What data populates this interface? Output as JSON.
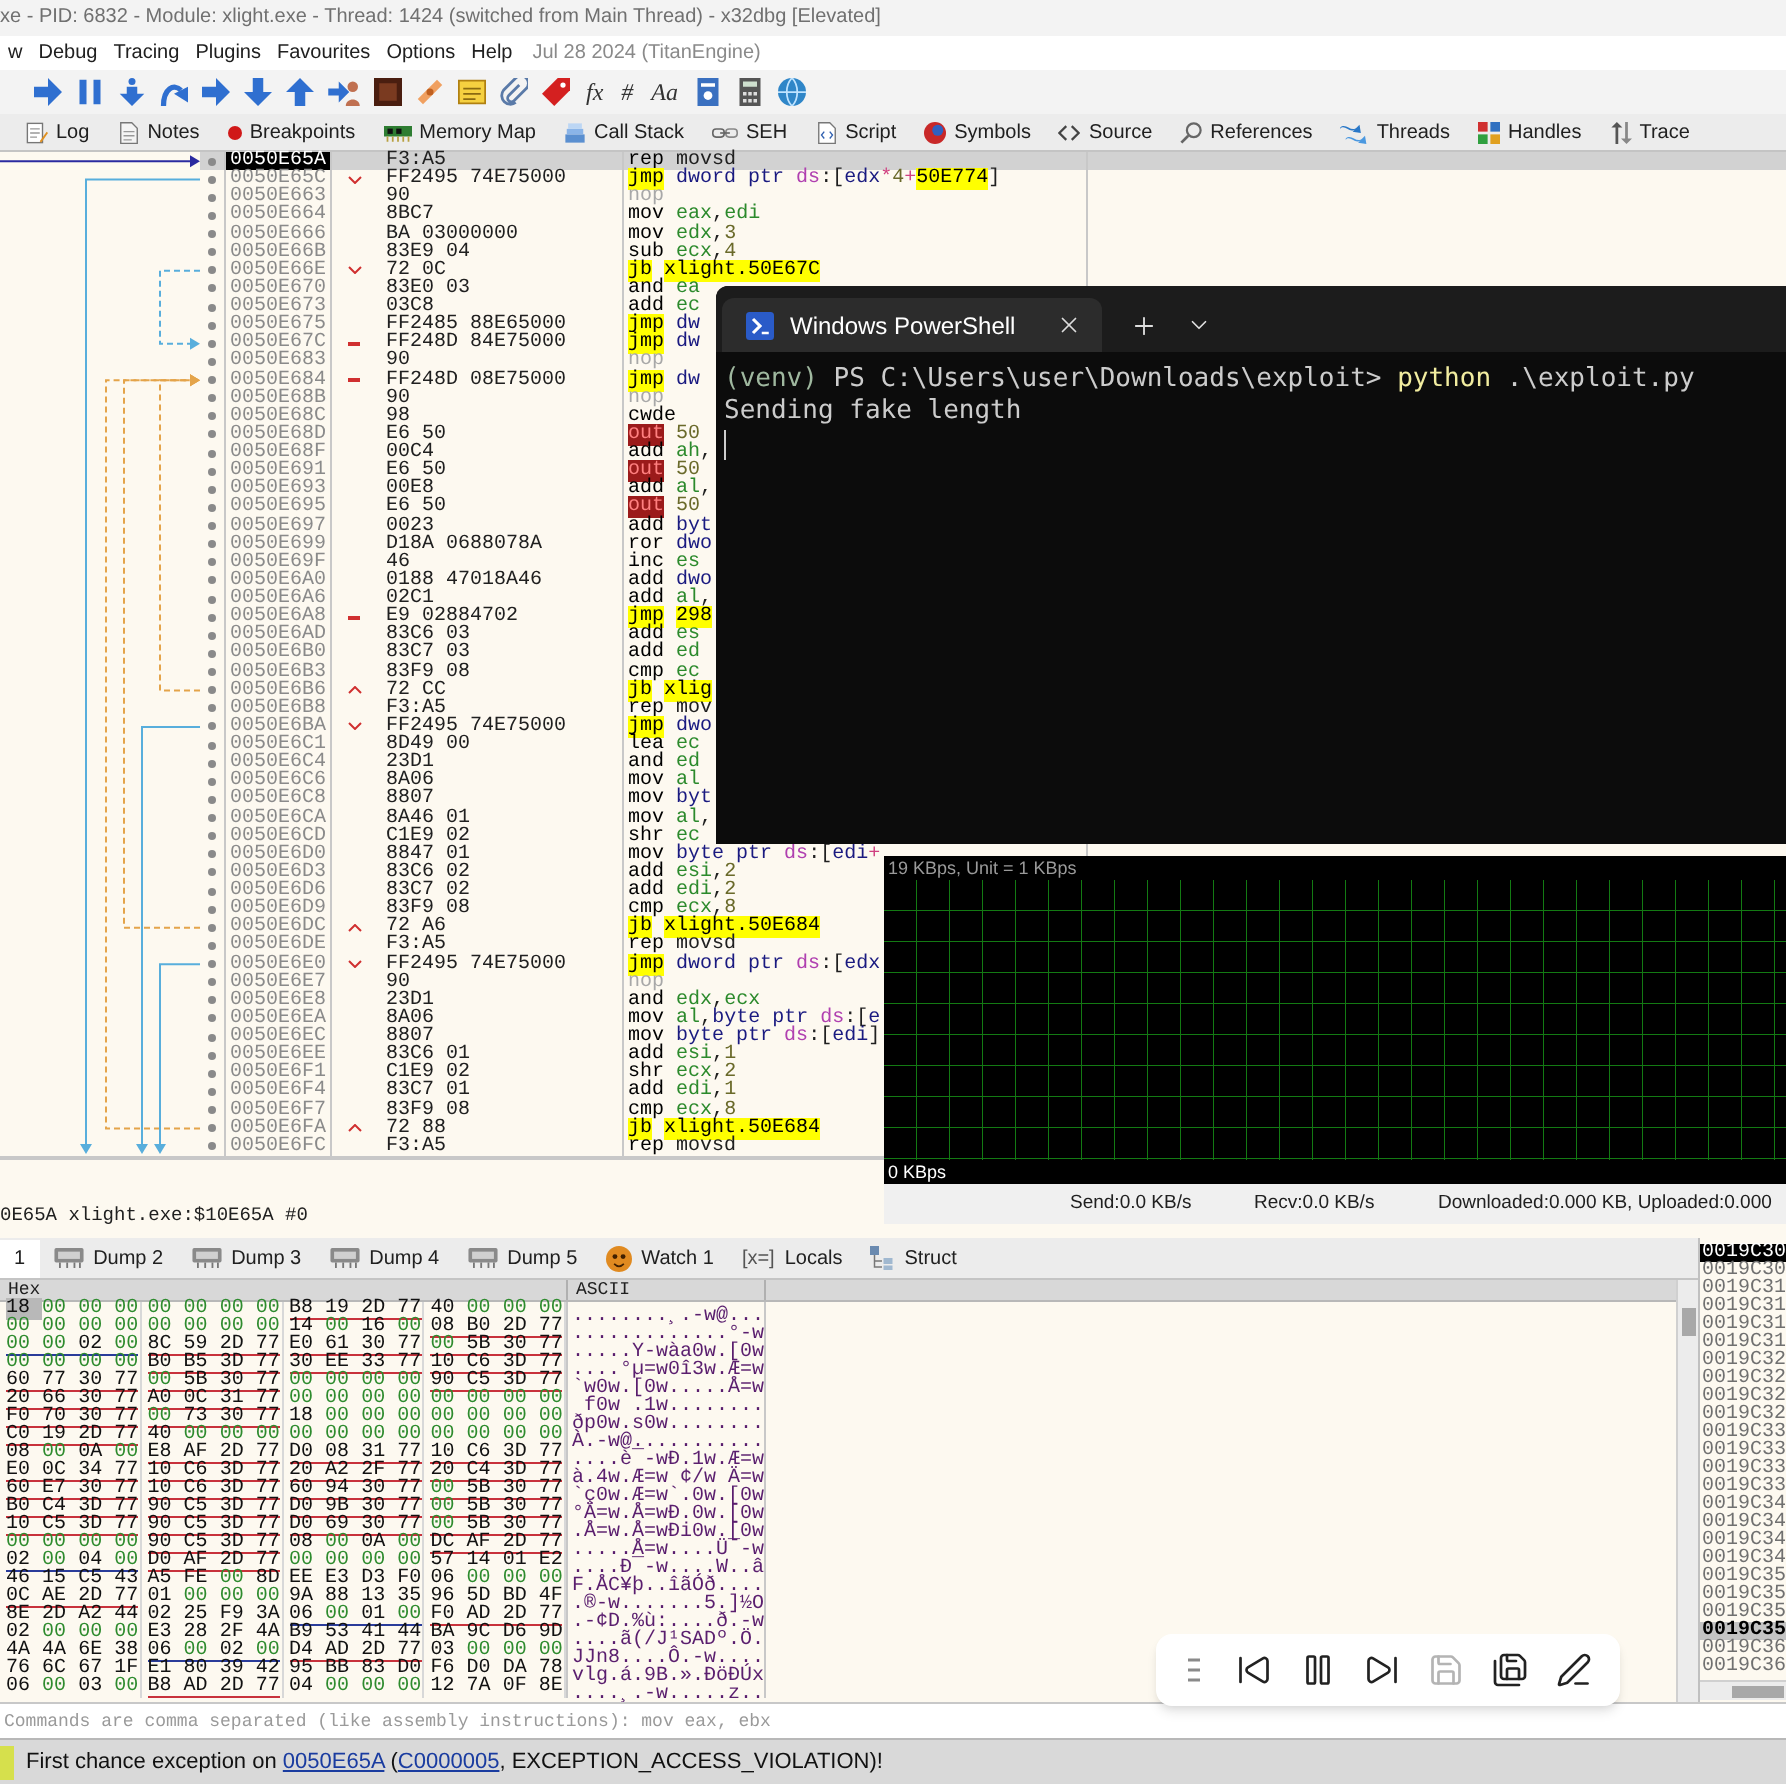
{
  "window": {
    "title": "xe - PID: 6832 - Module: xlight.exe - Thread: 1424 (switched from Main Thread) - x32dbg [Elevated]"
  },
  "menu": {
    "items": [
      "w",
      "Debug",
      "Tracing",
      "Plugins",
      "Favourites",
      "Options",
      "Help"
    ],
    "build_info": "Jul 28 2024 (TitanEngine)"
  },
  "toolbar": [
    {
      "kind": "run"
    },
    {
      "kind": "pause"
    },
    {
      "kind": "step-into"
    },
    {
      "kind": "step-over"
    },
    {
      "kind": "run-right"
    },
    {
      "kind": "run-down"
    },
    {
      "kind": "run-up"
    },
    {
      "kind": "run-user"
    },
    {
      "kind": "tile"
    },
    {
      "kind": "bandage"
    },
    {
      "kind": "note"
    },
    {
      "kind": "clip"
    },
    {
      "kind": "tag"
    },
    {
      "kind": "text",
      "label": "fx"
    },
    {
      "kind": "text",
      "label": "#"
    },
    {
      "kind": "text",
      "label": "Aa"
    },
    {
      "kind": "doc"
    },
    {
      "kind": "calc"
    },
    {
      "kind": "globe"
    }
  ],
  "tabs": [
    {
      "label": "Log",
      "kind": "log",
      "selected": false
    },
    {
      "label": "Notes",
      "kind": "notes",
      "selected": false
    },
    {
      "label": "Breakpoints",
      "kind": "breakpoints",
      "selected": false
    },
    {
      "label": "Memory Map",
      "kind": "memory",
      "selected": false
    },
    {
      "label": "Call Stack",
      "kind": "callstack",
      "selected": false
    },
    {
      "label": "SEH",
      "kind": "seh",
      "selected": false
    },
    {
      "label": "Script",
      "kind": "script",
      "selected": false
    },
    {
      "label": "Symbols",
      "kind": "symbols",
      "selected": false
    },
    {
      "label": "Source",
      "kind": "source",
      "selected": false
    },
    {
      "label": "References",
      "kind": "references",
      "selected": false
    },
    {
      "label": "Threads",
      "kind": "threads",
      "selected": false
    },
    {
      "label": "Handles",
      "kind": "handles",
      "selected": false
    },
    {
      "label": "Trace",
      "kind": "trace",
      "selected": false
    }
  ],
  "disassembly": {
    "rows": [
      {
        "address": "0050E65A",
        "bytes": "F3:A5",
        "selected": true,
        "instr": [
          {
            "text": "rep",
            "kind": "mn"
          },
          {
            "text": " movsd",
            "kind": "p"
          }
        ]
      },
      {
        "address": "0050E65C",
        "bytes": "FF2495 74E75000",
        "selected": false,
        "branch": {
          "kind": "down"
        },
        "instr": [
          {
            "text": "jmp",
            "kind": "jmp"
          },
          {
            "text": " dword ptr ",
            "kind": "size"
          },
          {
            "text": "ds",
            "kind": "seg"
          },
          {
            "text": ":[",
            "kind": "p"
          },
          {
            "text": "edx",
            "kind": "size"
          },
          {
            "text": "*",
            "kind": "op"
          },
          {
            "text": "4",
            "kind": "num"
          },
          {
            "text": "+",
            "kind": "op"
          },
          {
            "text": "50E774",
            "kind": "lbl"
          },
          {
            "text": "]",
            "kind": "p"
          }
        ]
      },
      {
        "address": "0050E663",
        "bytes": "90",
        "selected": false,
        "instr": [
          {
            "text": "nop",
            "kind": "nop"
          }
        ]
      },
      {
        "address": "0050E664",
        "bytes": "8BC7",
        "selected": false,
        "instr": [
          {
            "text": "mov",
            "kind": "mn"
          },
          {
            "text": " eax",
            "kind": "reg"
          },
          {
            "text": ",",
            "kind": "p"
          },
          {
            "text": "edi",
            "kind": "reg"
          }
        ]
      },
      {
        "address": "0050E666",
        "bytes": "BA 03000000",
        "selected": false,
        "instr": [
          {
            "text": "mov",
            "kind": "mn"
          },
          {
            "text": " edx",
            "kind": "reg"
          },
          {
            "text": ",",
            "kind": "p"
          },
          {
            "text": "3",
            "kind": "num"
          }
        ]
      },
      {
        "address": "0050E66B",
        "bytes": "83E9 04",
        "selected": false,
        "instr": [
          {
            "text": "sub",
            "kind": "mn"
          },
          {
            "text": " ecx",
            "kind": "reg"
          },
          {
            "text": ",",
            "kind": "p"
          },
          {
            "text": "4",
            "kind": "num"
          }
        ]
      },
      {
        "address": "0050E66E",
        "bytes": "72 0C",
        "selected": false,
        "branch": {
          "kind": "down"
        },
        "instr": [
          {
            "text": "jb",
            "kind": "jmp"
          },
          {
            "text": " xlight.50E67C",
            "kind": "lbl"
          }
        ]
      },
      {
        "address": "0050E670",
        "bytes": "83E0 03",
        "selected": false,
        "instr": [
          {
            "text": "and",
            "kind": "mn"
          },
          {
            "text": " ea",
            "kind": "reg"
          }
        ]
      },
      {
        "address": "0050E673",
        "bytes": "03C8",
        "selected": false,
        "instr": [
          {
            "text": "add",
            "kind": "mn"
          },
          {
            "text": " ec",
            "kind": "reg"
          }
        ]
      },
      {
        "address": "0050E675",
        "bytes": "FF2485 88E65000",
        "selected": false,
        "instr": [
          {
            "text": "jmp",
            "kind": "jmp"
          },
          {
            "text": " dw",
            "kind": "size"
          }
        ]
      },
      {
        "address": "0050E67C",
        "bytes": "FF248D 84E75000",
        "selected": false,
        "branch": {
          "kind": "far"
        },
        "instr": [
          {
            "text": "jmp",
            "kind": "jmp"
          },
          {
            "text": " dw",
            "kind": "size"
          }
        ]
      },
      {
        "address": "0050E683",
        "bytes": "90",
        "selected": false,
        "instr": [
          {
            "text": "nop",
            "kind": "nop"
          }
        ]
      },
      {
        "address": "0050E684",
        "bytes": "FF248D 08E75000",
        "selected": false,
        "branch": {
          "kind": "far"
        },
        "instr": [
          {
            "text": "jmp",
            "kind": "jmp"
          },
          {
            "text": " dw",
            "kind": "size"
          }
        ]
      },
      {
        "address": "0050E68B",
        "bytes": "90",
        "selected": false,
        "instr": [
          {
            "text": "nop",
            "kind": "nop"
          }
        ]
      },
      {
        "address": "0050E68C",
        "bytes": "98",
        "selected": false,
        "instr": [
          {
            "text": "cwde",
            "kind": "mn"
          }
        ]
      },
      {
        "address": "0050E68D",
        "bytes": "E6 50",
        "selected": false,
        "instr": [
          {
            "text": "out",
            "kind": "bad"
          },
          {
            "text": " 50",
            "kind": "num"
          }
        ]
      },
      {
        "address": "0050E68F",
        "bytes": "00C4",
        "selected": false,
        "instr": [
          {
            "text": "add",
            "kind": "mn"
          },
          {
            "text": " ah",
            "kind": "reg"
          },
          {
            "text": ",",
            "kind": "p"
          }
        ]
      },
      {
        "address": "0050E691",
        "bytes": "E6 50",
        "selected": false,
        "instr": [
          {
            "text": "out",
            "kind": "bad"
          },
          {
            "text": " 50",
            "kind": "num"
          }
        ]
      },
      {
        "address": "0050E693",
        "bytes": "00E8",
        "selected": false,
        "instr": [
          {
            "text": "add",
            "kind": "mn"
          },
          {
            "text": " al",
            "kind": "reg"
          },
          {
            "text": ",",
            "kind": "p"
          }
        ]
      },
      {
        "address": "0050E695",
        "bytes": "E6 50",
        "selected": false,
        "instr": [
          {
            "text": "out",
            "kind": "bad"
          },
          {
            "text": " 50",
            "kind": "num"
          }
        ]
      },
      {
        "address": "0050E697",
        "bytes": "0023",
        "selected": false,
        "instr": [
          {
            "text": "add",
            "kind": "mn"
          },
          {
            "text": " byt",
            "kind": "size"
          }
        ]
      },
      {
        "address": "0050E699",
        "bytes": "D18A 0688078A",
        "selected": false,
        "instr": [
          {
            "text": "ror",
            "kind": "mn"
          },
          {
            "text": " dwo",
            "kind": "size"
          }
        ]
      },
      {
        "address": "0050E69F",
        "bytes": "46",
        "selected": false,
        "instr": [
          {
            "text": "inc",
            "kind": "mn"
          },
          {
            "text": " es",
            "kind": "reg"
          }
        ]
      },
      {
        "address": "0050E6A0",
        "bytes": "0188 47018A46",
        "selected": false,
        "instr": [
          {
            "text": "add",
            "kind": "mn"
          },
          {
            "text": " dwo",
            "kind": "size"
          }
        ]
      },
      {
        "address": "0050E6A6",
        "bytes": "02C1",
        "selected": false,
        "instr": [
          {
            "text": "add",
            "kind": "mn"
          },
          {
            "text": " al",
            "kind": "reg"
          },
          {
            "text": ",",
            "kind": "p"
          }
        ]
      },
      {
        "address": "0050E6A8",
        "bytes": "E9 02884702",
        "selected": false,
        "branch": {
          "kind": "far"
        },
        "instr": [
          {
            "text": "jmp",
            "kind": "jmp"
          },
          {
            "text": " 298",
            "kind": "lbl"
          }
        ]
      },
      {
        "address": "0050E6AD",
        "bytes": "83C6 03",
        "selected": false,
        "instr": [
          {
            "text": "add",
            "kind": "mn"
          },
          {
            "text": " es",
            "kind": "reg"
          }
        ]
      },
      {
        "address": "0050E6B0",
        "bytes": "83C7 03",
        "selected": false,
        "instr": [
          {
            "text": "add",
            "kind": "mn"
          },
          {
            "text": " ed",
            "kind": "reg"
          }
        ]
      },
      {
        "address": "0050E6B3",
        "bytes": "83F9 08",
        "selected": false,
        "instr": [
          {
            "text": "cmp",
            "kind": "mn"
          },
          {
            "text": " ec",
            "kind": "reg"
          }
        ]
      },
      {
        "address": "0050E6B6",
        "bytes": "72 CC",
        "selected": false,
        "branch": {
          "kind": "up"
        },
        "instr": [
          {
            "text": "jb",
            "kind": "jmp"
          },
          {
            "text": " xlig",
            "kind": "lbl"
          }
        ]
      },
      {
        "address": "0050E6B8",
        "bytes": "F3:A5",
        "selected": false,
        "instr": [
          {
            "text": "rep",
            "kind": "mn"
          },
          {
            "text": " mov",
            "kind": "p"
          }
        ]
      },
      {
        "address": "0050E6BA",
        "bytes": "FF2495 74E75000",
        "selected": false,
        "branch": {
          "kind": "down"
        },
        "instr": [
          {
            "text": "jmp",
            "kind": "jmp"
          },
          {
            "text": " dwo",
            "kind": "size"
          }
        ]
      },
      {
        "address": "0050E6C1",
        "bytes": "8D49 00",
        "selected": false,
        "instr": [
          {
            "text": "lea",
            "kind": "mn"
          },
          {
            "text": " ec",
            "kind": "reg"
          }
        ]
      },
      {
        "address": "0050E6C4",
        "bytes": "23D1",
        "selected": false,
        "instr": [
          {
            "text": "and",
            "kind": "mn"
          },
          {
            "text": " ed",
            "kind": "reg"
          }
        ]
      },
      {
        "address": "0050E6C6",
        "bytes": "8A06",
        "selected": false,
        "instr": [
          {
            "text": "mov",
            "kind": "mn"
          },
          {
            "text": " al",
            "kind": "reg"
          }
        ]
      },
      {
        "address": "0050E6C8",
        "bytes": "8807",
        "selected": false,
        "instr": [
          {
            "text": "mov",
            "kind": "mn"
          },
          {
            "text": " byt",
            "kind": "size"
          }
        ]
      },
      {
        "address": "0050E6CA",
        "bytes": "8A46 01",
        "selected": false,
        "instr": [
          {
            "text": "mov",
            "kind": "mn"
          },
          {
            "text": " al",
            "kind": "reg"
          },
          {
            "text": ",",
            "kind": "p"
          }
        ]
      },
      {
        "address": "0050E6CD",
        "bytes": "C1E9 02",
        "selected": false,
        "instr": [
          {
            "text": "shr",
            "kind": "mn"
          },
          {
            "text": " ec",
            "kind": "reg"
          }
        ]
      },
      {
        "address": "0050E6D0",
        "bytes": "8847 01",
        "selected": false,
        "instr": [
          {
            "text": "mov",
            "kind": "mn"
          },
          {
            "text": " byte ptr ",
            "kind": "size"
          },
          {
            "text": "ds",
            "kind": "seg"
          },
          {
            "text": ":[",
            "kind": "p"
          },
          {
            "text": "edi",
            "kind": "size"
          },
          {
            "text": "+",
            "kind": "op"
          }
        ]
      },
      {
        "address": "0050E6D3",
        "bytes": "83C6 02",
        "selected": false,
        "instr": [
          {
            "text": "add",
            "kind": "mn"
          },
          {
            "text": " esi",
            "kind": "reg"
          },
          {
            "text": ",",
            "kind": "p"
          },
          {
            "text": "2",
            "kind": "num"
          }
        ]
      },
      {
        "address": "0050E6D6",
        "bytes": "83C7 02",
        "selected": false,
        "instr": [
          {
            "text": "add",
            "kind": "mn"
          },
          {
            "text": " edi",
            "kind": "reg"
          },
          {
            "text": ",",
            "kind": "p"
          },
          {
            "text": "2",
            "kind": "num"
          }
        ]
      },
      {
        "address": "0050E6D9",
        "bytes": "83F9 08",
        "selected": false,
        "instr": [
          {
            "text": "cmp",
            "kind": "mn"
          },
          {
            "text": " ecx",
            "kind": "reg"
          },
          {
            "text": ",",
            "kind": "p"
          },
          {
            "text": "8",
            "kind": "num"
          }
        ]
      },
      {
        "address": "0050E6DC",
        "bytes": "72 A6",
        "selected": false,
        "branch": {
          "kind": "up"
        },
        "instr": [
          {
            "text": "jb",
            "kind": "jmp"
          },
          {
            "text": " xlight.50E684",
            "kind": "lbl"
          }
        ]
      },
      {
        "address": "0050E6DE",
        "bytes": "F3:A5",
        "selected": false,
        "instr": [
          {
            "text": "rep",
            "kind": "mn"
          },
          {
            "text": " movsd",
            "kind": "p"
          }
        ]
      },
      {
        "address": "0050E6E0",
        "bytes": "FF2495 74E75000",
        "selected": false,
        "branch": {
          "kind": "down"
        },
        "instr": [
          {
            "text": "jmp",
            "kind": "jmp"
          },
          {
            "text": " dword ptr ",
            "kind": "size"
          },
          {
            "text": "ds",
            "kind": "seg"
          },
          {
            "text": ":[",
            "kind": "p"
          },
          {
            "text": "edx",
            "kind": "size"
          }
        ]
      },
      {
        "address": "0050E6E7",
        "bytes": "90",
        "selected": false,
        "instr": [
          {
            "text": "nop",
            "kind": "nop"
          }
        ]
      },
      {
        "address": "0050E6E8",
        "bytes": "23D1",
        "selected": false,
        "instr": [
          {
            "text": "and",
            "kind": "mn"
          },
          {
            "text": " edx",
            "kind": "reg"
          },
          {
            "text": ",",
            "kind": "p"
          },
          {
            "text": "ecx",
            "kind": "reg"
          }
        ]
      },
      {
        "address": "0050E6EA",
        "bytes": "8A06",
        "selected": false,
        "instr": [
          {
            "text": "mov",
            "kind": "mn"
          },
          {
            "text": " al",
            "kind": "reg"
          },
          {
            "text": ",",
            "kind": "p"
          },
          {
            "text": "byte ptr ",
            "kind": "size"
          },
          {
            "text": "ds",
            "kind": "seg"
          },
          {
            "text": ":[",
            "kind": "p"
          },
          {
            "text": "e",
            "kind": "size"
          }
        ]
      },
      {
        "address": "0050E6EC",
        "bytes": "8807",
        "selected": false,
        "instr": [
          {
            "text": "mov",
            "kind": "mn"
          },
          {
            "text": " byte ptr ",
            "kind": "size"
          },
          {
            "text": "ds",
            "kind": "seg"
          },
          {
            "text": ":[",
            "kind": "p"
          },
          {
            "text": "edi",
            "kind": "size"
          },
          {
            "text": "]",
            "kind": "p"
          }
        ]
      },
      {
        "address": "0050E6EE",
        "bytes": "83C6 01",
        "selected": false,
        "instr": [
          {
            "text": "add",
            "kind": "mn"
          },
          {
            "text": " esi",
            "kind": "reg"
          },
          {
            "text": ",",
            "kind": "p"
          },
          {
            "text": "1",
            "kind": "num"
          }
        ]
      },
      {
        "address": "0050E6F1",
        "bytes": "C1E9 02",
        "selected": false,
        "instr": [
          {
            "text": "shr",
            "kind": "mn"
          },
          {
            "text": " ecx",
            "kind": "reg"
          },
          {
            "text": ",",
            "kind": "p"
          },
          {
            "text": "2",
            "kind": "num"
          }
        ]
      },
      {
        "address": "0050E6F4",
        "bytes": "83C7 01",
        "selected": false,
        "instr": [
          {
            "text": "add",
            "kind": "mn"
          },
          {
            "text": " edi",
            "kind": "reg"
          },
          {
            "text": ",",
            "kind": "p"
          },
          {
            "text": "1",
            "kind": "num"
          }
        ]
      },
      {
        "address": "0050E6F7",
        "bytes": "83F9 08",
        "selected": false,
        "instr": [
          {
            "text": "cmp",
            "kind": "mn"
          },
          {
            "text": " ecx",
            "kind": "reg"
          },
          {
            "text": ",",
            "kind": "p"
          },
          {
            "text": "8",
            "kind": "num"
          }
        ]
      },
      {
        "address": "0050E6FA",
        "bytes": "72 88",
        "selected": false,
        "branch": {
          "kind": "up"
        },
        "instr": [
          {
            "text": "jb",
            "kind": "jmp"
          },
          {
            "text": " xlight.50E684",
            "kind": "lbl"
          }
        ]
      },
      {
        "address": "0050E6FC",
        "bytes": "F3:A5",
        "selected": false,
        "instr": [
          {
            "text": "rep",
            "kind": "mn"
          },
          {
            "text": " movsd",
            "kind": "p"
          }
        ]
      }
    ]
  },
  "terminal": {
    "tab": {
      "title": "Windows PowerShell",
      "selected": true
    },
    "lines": [
      [
        {
          "text": "(venv) ",
          "kind": "venv"
        },
        {
          "text": "PS C:\\Users\\user\\Downloads\\exploit> ",
          "kind": "plain"
        },
        {
          "text": "python",
          "kind": "cmd"
        },
        {
          "text": " .\\exploit.py",
          "kind": "plain"
        }
      ],
      [
        {
          "text": "Sending fake length",
          "kind": "plain"
        }
      ]
    ],
    "cursor": true
  },
  "net_monitor": {
    "scale": "19 KBps, Unit = 1 KBps",
    "zero": "0 KBps",
    "status": [
      "Send:0.0 KB/s",
      "Recv:0.0 KB/s",
      "Downloaded:0.000 KB, Uploaded:0.000"
    ]
  },
  "info_line": "0E65A xlight.exe:$10E65A #0",
  "dump_tabs": [
    {
      "label": "1",
      "kind": "clipped",
      "selected": true
    },
    {
      "label": "Dump 2",
      "kind": "dump",
      "selected": false
    },
    {
      "label": "Dump 3",
      "kind": "dump",
      "selected": false
    },
    {
      "label": "Dump 4",
      "kind": "dump",
      "selected": false
    },
    {
      "label": "Dump 5",
      "kind": "dump",
      "selected": false
    },
    {
      "label": "Watch 1",
      "kind": "watch",
      "selected": false
    },
    {
      "label": "Locals",
      "kind": "locals",
      "glyph": "[x=]",
      "selected": false
    },
    {
      "label": "Struct",
      "kind": "struct",
      "selected": false
    }
  ],
  "hex": {
    "columns": [
      "Hex",
      "ASCII"
    ],
    "rows": [
      {
        "selected": true,
        "groups": [
          {
            "bytes": "18 00 00 00"
          },
          {
            "bytes": "00 00 00 00"
          },
          {
            "bytes": "B8 19 2D 77",
            "color": "#c8323c"
          },
          {
            "bytes": "40 00 00 00"
          }
        ],
        "ascii": "........¸.-w@..."
      },
      {
        "selected": false,
        "groups": [
          {
            "bytes": "00 00 00 00"
          },
          {
            "bytes": "00 00 00 00"
          },
          {
            "bytes": "14 00 16 00"
          },
          {
            "bytes": "08 B0 2D 77",
            "color": "#c8323c"
          }
        ],
        "ascii": ".............°-w"
      },
      {
        "selected": false,
        "groups": [
          {
            "bytes": "00 00 02 00",
            "color": "#2a3c9a"
          },
          {
            "bytes": "8C 59 2D 77",
            "color": "#c8323c"
          },
          {
            "bytes": "E0 61 30 77",
            "color": "#c8323c"
          },
          {
            "bytes": "00 5B 30 77",
            "color": "#c8323c"
          }
        ],
        "ascii": ".....Y-wàa0w.[0w"
      },
      {
        "selected": false,
        "groups": [
          {
            "bytes": "00 00 00 00"
          },
          {
            "bytes": "B0 B5 3D 77",
            "color": "#c8323c"
          },
          {
            "bytes": "30 EE 33 77",
            "color": "#c8323c"
          },
          {
            "bytes": "10 C6 3D 77",
            "color": "#c8323c"
          }
        ],
        "ascii": "....°µ=w0î3w.Æ=w"
      },
      {
        "selected": false,
        "groups": [
          {
            "bytes": "60 77 30 77",
            "color": "#c8323c"
          },
          {
            "bytes": "00 5B 30 77",
            "color": "#c8323c"
          },
          {
            "bytes": "00 00 00 00"
          },
          {
            "bytes": "90 C5 3D 77",
            "color": "#c8323c"
          }
        ],
        "ascii": "`w0w.[0w.....Å=w"
      },
      {
        "selected": false,
        "groups": [
          {
            "bytes": "20 66 30 77",
            "color": "#c8323c"
          },
          {
            "bytes": "A0 0C 31 77",
            "color": "#c8323c"
          },
          {
            "bytes": "00 00 00 00"
          },
          {
            "bytes": "00 00 00 00"
          }
        ],
        "ascii": " f0w .1w........"
      },
      {
        "selected": false,
        "groups": [
          {
            "bytes": "F0 70 30 77",
            "color": "#c8323c"
          },
          {
            "bytes": "00 73 30 77",
            "color": "#c8323c"
          },
          {
            "bytes": "18 00 00 00"
          },
          {
            "bytes": "00 00 00 00"
          }
        ],
        "ascii": "ðp0w.s0w........"
      },
      {
        "selected": false,
        "groups": [
          {
            "bytes": "C0 19 2D 77",
            "color": "#c8323c"
          },
          {
            "bytes": "40 00 00 00"
          },
          {
            "bytes": "00 00 00 00"
          },
          {
            "bytes": "00 00 00 00"
          }
        ],
        "ascii": "À.-w@..........."
      },
      {
        "selected": false,
        "groups": [
          {
            "bytes": "08 00 0A 00"
          },
          {
            "bytes": "E8 AF 2D 77",
            "color": "#c8323c"
          },
          {
            "bytes": "D0 08 31 77",
            "color": "#c8323c"
          },
          {
            "bytes": "10 C6 3D 77",
            "color": "#c8323c"
          }
        ],
        "ascii": "....è¯-wÐ.1w.Æ=w"
      },
      {
        "selected": false,
        "groups": [
          {
            "bytes": "E0 0C 34 77",
            "color": "#c8323c"
          },
          {
            "bytes": "10 C6 3D 77",
            "color": "#c8323c"
          },
          {
            "bytes": "20 A2 2F 77",
            "color": "#c8323c"
          },
          {
            "bytes": "20 C4 3D 77",
            "color": "#c8323c"
          }
        ],
        "ascii": "à.4w.Æ=w ¢/w Ä=w"
      },
      {
        "selected": false,
        "groups": [
          {
            "bytes": "60 E7 30 77",
            "color": "#c8323c"
          },
          {
            "bytes": "10 C6 3D 77",
            "color": "#c8323c"
          },
          {
            "bytes": "60 94 30 77",
            "color": "#c8323c"
          },
          {
            "bytes": "00 5B 30 77",
            "color": "#c8323c"
          }
        ],
        "ascii": "`ç0w.Æ=w`.0w.[0w"
      },
      {
        "selected": false,
        "groups": [
          {
            "bytes": "B0 C4 3D 77",
            "color": "#c8323c"
          },
          {
            "bytes": "90 C5 3D 77",
            "color": "#c8323c"
          },
          {
            "bytes": "D0 9B 30 77",
            "color": "#c8323c"
          },
          {
            "bytes": "00 5B 30 77",
            "color": "#c8323c"
          }
        ],
        "ascii": "°Ä=w.Å=wÐ.0w.[0w"
      },
      {
        "selected": false,
        "groups": [
          {
            "bytes": "10 C5 3D 77",
            "color": "#c8323c"
          },
          {
            "bytes": "90 C5 3D 77",
            "color": "#c8323c"
          },
          {
            "bytes": "D0 69 30 77",
            "color": "#c8323c"
          },
          {
            "bytes": "00 5B 30 77",
            "color": "#c8323c"
          }
        ],
        "ascii": ".Å=w.Å=wÐi0w.[0w"
      },
      {
        "selected": false,
        "groups": [
          {
            "bytes": "00 00 00 00"
          },
          {
            "bytes": "90 C5 3D 77",
            "color": "#c8323c"
          },
          {
            "bytes": "08 00 0A 00"
          },
          {
            "bytes": "DC AF 2D 77",
            "color": "#c8323c"
          }
        ],
        "ascii": ".....Å=w....Ü¯-w"
      },
      {
        "selected": false,
        "groups": [
          {
            "bytes": "02 00 04 00",
            "color": "#2a3c9a"
          },
          {
            "bytes": "D0 AF 2D 77",
            "color": "#c8323c"
          },
          {
            "bytes": "00 00 00 00"
          },
          {
            "bytes": "57 14 01 E2"
          }
        ],
        "ascii": "....Ð¯-w....W..â"
      },
      {
        "selected": false,
        "groups": [
          {
            "bytes": "46 15 C5 43"
          },
          {
            "bytes": "A5 FE 00 8D"
          },
          {
            "bytes": "EE E3 D3 F0"
          },
          {
            "bytes": "06 00 00 00"
          }
        ],
        "ascii": "F.ÅC¥þ..îãÓð...."
      },
      {
        "selected": false,
        "groups": [
          {
            "bytes": "0C AE 2D 77",
            "color": "#c8323c"
          },
          {
            "bytes": "01 00 00 00"
          },
          {
            "bytes": "9A 88 13 35"
          },
          {
            "bytes": "96 5D BD 4F"
          }
        ],
        "ascii": ".®-w.......5.]½O"
      },
      {
        "selected": false,
        "groups": [
          {
            "bytes": "8E 2D A2 44"
          },
          {
            "bytes": "02 25 F9 3A"
          },
          {
            "bytes": "06 00 01 00",
            "color": "#2a3c9a"
          },
          {
            "bytes": "F0 AD 2D 77",
            "color": "#c8323c"
          }
        ],
        "ascii": ".-¢D.%ù:....ð.-w"
      },
      {
        "selected": false,
        "groups": [
          {
            "bytes": "02 00 00 00"
          },
          {
            "bytes": "E3 28 2F 4A"
          },
          {
            "bytes": "B9 53 41 44"
          },
          {
            "bytes": "BA 9C D6 9D"
          }
        ],
        "ascii": "....ã(/J¹SADº.Ö."
      },
      {
        "selected": false,
        "groups": [
          {
            "bytes": "4A 4A 6E 38"
          },
          {
            "bytes": "06 00 02 00",
            "color": "#2a3c9a"
          },
          {
            "bytes": "D4 AD 2D 77",
            "color": "#c8323c"
          },
          {
            "bytes": "03 00 00 00"
          }
        ],
        "ascii": "JJn8....Ô.-w...."
      },
      {
        "selected": false,
        "groups": [
          {
            "bytes": "76 6C 67 1F"
          },
          {
            "bytes": "E1 80 39 42"
          },
          {
            "bytes": "95 BB 83 D0"
          },
          {
            "bytes": "F6 D0 DA 78"
          }
        ],
        "ascii": "vlg.á.9B.».ÐöÐÚx"
      },
      {
        "selected": false,
        "groups": [
          {
            "bytes": "06 00 03 00"
          },
          {
            "bytes": "B8 AD 2D 77",
            "color": "#c8323c"
          },
          {
            "bytes": "04 00 00 00"
          },
          {
            "bytes": "12 7A 0F 8E"
          }
        ],
        "ascii": "....¸.-w.....z.."
      }
    ]
  },
  "stack": [
    {
      "address": "0019C30",
      "selected": true,
      "highlighted": false
    },
    {
      "address": "0019C30",
      "selected": false,
      "highlighted": false
    },
    {
      "address": "0019C31",
      "selected": false,
      "highlighted": false
    },
    {
      "address": "0019C31",
      "selected": false,
      "highlighted": false
    },
    {
      "address": "0019C31",
      "selected": false,
      "highlighted": false
    },
    {
      "address": "0019C31",
      "selected": false,
      "highlighted": false
    },
    {
      "address": "0019C32",
      "selected": false,
      "highlighted": false
    },
    {
      "address": "0019C32",
      "selected": false,
      "highlighted": false
    },
    {
      "address": "0019C32",
      "selected": false,
      "highlighted": false
    },
    {
      "address": "0019C32",
      "selected": false,
      "highlighted": false
    },
    {
      "address": "0019C33",
      "selected": false,
      "highlighted": false
    },
    {
      "address": "0019C33",
      "selected": false,
      "highlighted": false
    },
    {
      "address": "0019C33",
      "selected": false,
      "highlighted": false
    },
    {
      "address": "0019C33",
      "selected": false,
      "highlighted": false
    },
    {
      "address": "0019C34",
      "selected": false,
      "highlighted": false
    },
    {
      "address": "0019C34",
      "selected": false,
      "highlighted": false
    },
    {
      "address": "0019C34",
      "selected": false,
      "highlighted": false
    },
    {
      "address": "0019C34",
      "selected": false,
      "highlighted": false
    },
    {
      "address": "0019C35",
      "selected": false,
      "highlighted": false
    },
    {
      "address": "0019C35",
      "selected": false,
      "highlighted": false
    },
    {
      "address": "0019C35",
      "selected": false,
      "highlighted": false
    },
    {
      "address": "0019C35",
      "selected": false,
      "highlighted": true
    },
    {
      "address": "0019C36",
      "selected": false,
      "highlighted": false
    },
    {
      "address": "0019C36",
      "selected": false,
      "highlighted": false
    }
  ],
  "recorder": [
    {
      "kind": "previous",
      "disabled": false
    },
    {
      "kind": "pause",
      "disabled": false
    },
    {
      "kind": "next",
      "disabled": false
    },
    {
      "kind": "save",
      "disabled": true
    },
    {
      "kind": "save-all",
      "disabled": false
    },
    {
      "kind": "edit",
      "disabled": false
    }
  ],
  "command": {
    "placeholder": "Commands are comma separated (like assembly instructions): mov eax, ebx"
  },
  "status_bar": {
    "parts": [
      {
        "text": "First chance exception on ",
        "kind": "text"
      },
      {
        "text": "0050E65A",
        "kind": "link"
      },
      {
        "text": " (",
        "kind": "text"
      },
      {
        "text": "C0000005",
        "kind": "link"
      },
      {
        "text": ", EXCEPTION_ACCESS_VIOLATION)!",
        "kind": "text"
      }
    ]
  }
}
